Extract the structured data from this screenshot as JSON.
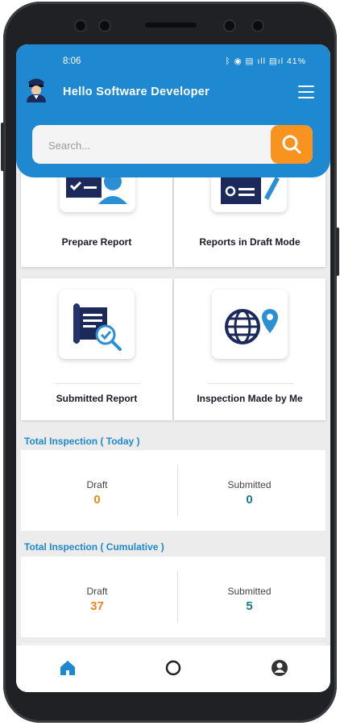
{
  "status_bar": {
    "time": "8:06",
    "icons_text": "ᛒ ◉ ▤ ıll ▤ıl 41%"
  },
  "header": {
    "greeting": "Hello  Software Developer"
  },
  "search": {
    "placeholder": "Search..."
  },
  "tiles": [
    {
      "label": "Prepare Report"
    },
    {
      "label": "Reports in Draft Mode"
    },
    {
      "label": "Submitted Report"
    },
    {
      "label": "Inspection Made by Me"
    }
  ],
  "today": {
    "title": "Total Inspection ( Today )",
    "draft_label": "Draft",
    "draft_value": "0",
    "submitted_label": "Submitted",
    "submitted_value": "0"
  },
  "cumulative": {
    "title": "Total Inspection ( Cumulative )",
    "draft_label": "Draft",
    "draft_value": "37",
    "submitted_label": "Submitted",
    "submitted_value": "5"
  },
  "nav": {
    "items": [
      "home-icon",
      "circle-icon",
      "account-icon"
    ]
  },
  "colors": {
    "primary": "#1e88d0",
    "accent": "#f7931e",
    "draft": "#e8891a",
    "submitted": "#1a7a8a",
    "navy": "#1b2a5a"
  }
}
